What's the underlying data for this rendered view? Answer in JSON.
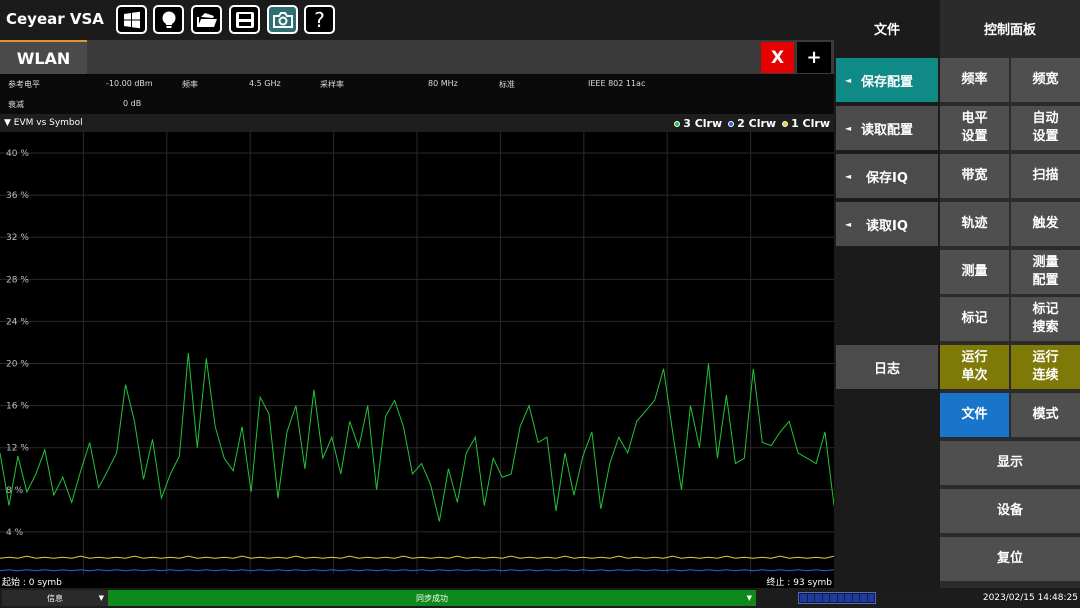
{
  "app": {
    "title": "Ceyear VSA"
  },
  "toolbar": {
    "icons": [
      "windows-icon",
      "lightbulb-icon",
      "open-folder-icon",
      "save-disk-icon",
      "camera-icon",
      "help-icon"
    ],
    "help_label": "?"
  },
  "tabs": {
    "active": "WLAN",
    "close_label": "X",
    "add_label": "+"
  },
  "info": {
    "ref_level_label": "参考电平",
    "ref_level_value": "-10.00 dBm",
    "freq_label": "频率",
    "freq_value": "4.5 GHz",
    "sample_label": "采样率",
    "sample_value": "80 MHz",
    "standard_label": "标准",
    "standard_value": "IEEE 802 11ac",
    "atten_label": "衰减",
    "atten_value": "0 dB"
  },
  "chart_header": {
    "title": "▼ EVM vs Symbol",
    "legend": [
      {
        "label": "3 Clrw",
        "color": "#22c43a"
      },
      {
        "label": "2 Clrw",
        "color": "#2f5ee8"
      },
      {
        "label": "1 Clrw",
        "color": "#e3d22b"
      }
    ]
  },
  "chart_data": {
    "type": "line",
    "title": "EVM vs Symbol",
    "xlabel": "",
    "ylabel": "",
    "x_range": [
      0,
      93
    ],
    "ylim": [
      0,
      42
    ],
    "yticks": [
      "40 %",
      "36 %",
      "32 %",
      "28 %",
      "24 %",
      "20 %",
      "16 %",
      "12 %",
      "8 %",
      "4 %"
    ],
    "ytick_values": [
      40,
      36,
      32,
      28,
      24,
      20,
      16,
      12,
      8,
      4
    ],
    "grid": true,
    "series": [
      {
        "name": "3 Clrw",
        "color": "#22c43a",
        "values": [
          11.5,
          6.5,
          11.2,
          7.8,
          9.5,
          11.8,
          7.5,
          9.2,
          6.8,
          9.8,
          12.5,
          8.2,
          9.8,
          11.5,
          18.0,
          14.5,
          9.0,
          12.8,
          7.2,
          9.5,
          11.2,
          21.0,
          12.0,
          20.5,
          14.0,
          11.0,
          9.8,
          14.0,
          7.8,
          16.8,
          15.2,
          7.2,
          13.5,
          16.0,
          10.0,
          17.5,
          11.0,
          13.0,
          9.5,
          14.5,
          12.0,
          16.0,
          8.0,
          15.0,
          16.5,
          14.0,
          9.5,
          10.5,
          8.5,
          5.0,
          10.0,
          6.8,
          11.5,
          13.0,
          6.5,
          11.0,
          9.2,
          9.5,
          14.0,
          16.0,
          12.5,
          13.0,
          6.0,
          11.5,
          7.5,
          11.2,
          13.5,
          6.2,
          10.5,
          13.0,
          11.5,
          14.5,
          15.5,
          16.5,
          19.5,
          13.5,
          8.0,
          16.0,
          12.0,
          20.0,
          11.0,
          17.0,
          10.5,
          11.0,
          19.5,
          12.5,
          12.2,
          13.5,
          14.5,
          11.5,
          11.0,
          10.5,
          13.5,
          6.5
        ]
      },
      {
        "name": "2 Clrw",
        "color": "#2f5ee8",
        "values": [
          0.3,
          0.4,
          0.3,
          0.4,
          0.3,
          0.4,
          0.3,
          0.4,
          0.3,
          0.4,
          0.3,
          0.4,
          0.3,
          0.4,
          0.3,
          0.4,
          0.3,
          0.4,
          0.3,
          0.4,
          0.3,
          0.4,
          0.3,
          0.4,
          0.3,
          0.4,
          0.3,
          0.4,
          0.3,
          0.4,
          0.3,
          0.4,
          0.3,
          0.4,
          0.3,
          0.4,
          0.3,
          0.4,
          0.3,
          0.4,
          0.3,
          0.4,
          0.3,
          0.4,
          0.3,
          0.4,
          0.3,
          0.4,
          0.3,
          0.4,
          0.3,
          0.4,
          0.3,
          0.4,
          0.3,
          0.4,
          0.3,
          0.4,
          0.3,
          0.4,
          0.3,
          0.4,
          0.3,
          0.4,
          0.3,
          0.4,
          0.3,
          0.4,
          0.3,
          0.4,
          0.3,
          0.4,
          0.3,
          0.4,
          0.3,
          0.4,
          0.3,
          0.4,
          0.3,
          0.4,
          0.3,
          0.4,
          0.3,
          0.4,
          0.3,
          0.4,
          0.3,
          0.4,
          0.3,
          0.4,
          0.3,
          0.4,
          0.3,
          0.4
        ]
      },
      {
        "name": "1 Clrw",
        "color": "#e3d22b",
        "values": [
          1.5,
          1.6,
          1.5,
          1.7,
          1.5,
          1.6,
          1.5,
          1.6,
          1.5,
          1.7,
          1.5,
          1.6,
          1.5,
          1.6,
          1.5,
          1.7,
          1.5,
          1.6,
          1.5,
          1.6,
          1.5,
          1.7,
          1.5,
          1.6,
          1.5,
          1.6,
          1.5,
          1.7,
          1.5,
          1.6,
          1.5,
          1.6,
          1.5,
          1.7,
          1.5,
          1.6,
          1.5,
          1.6,
          1.5,
          1.7,
          1.5,
          1.6,
          1.5,
          1.6,
          1.5,
          1.7,
          1.5,
          1.6,
          1.5,
          1.6,
          1.5,
          1.7,
          1.5,
          1.6,
          1.5,
          1.6,
          1.5,
          1.7,
          1.5,
          1.6,
          1.5,
          1.6,
          1.5,
          1.7,
          1.5,
          1.6,
          1.5,
          1.6,
          1.5,
          1.7,
          1.5,
          1.6,
          1.5,
          1.6,
          1.5,
          1.7,
          1.5,
          1.6,
          1.5,
          1.6,
          1.5,
          1.7,
          1.5,
          1.6,
          1.5,
          1.6,
          1.5,
          1.7,
          1.5,
          1.6,
          1.5,
          1.6,
          1.5,
          1.7,
          1.5,
          1.6
        ]
      }
    ]
  },
  "xaxis": {
    "start": "起始 : 0 symb",
    "stop": "终止 : 93 symb"
  },
  "status": {
    "info_label": "信息",
    "message": "同步成功",
    "datetime": "2023/02/15 14:48:25"
  },
  "file_panel": {
    "header": "文件",
    "items": [
      "保存配置",
      "读取配置",
      "保存IQ",
      "读取IQ"
    ],
    "log_label": "日志"
  },
  "control_panel": {
    "header": "控制面板",
    "freq": "频率",
    "span": "频宽",
    "level": "电平\n设置",
    "auto": "自动\n设置",
    "bandwidth": "带宽",
    "sweep": "扫描",
    "trace": "轨迹",
    "trigger": "触发",
    "measure": "测量",
    "meas_config": "测量\n配置",
    "marker": "标记",
    "marker_search": "标记\n搜索",
    "run_single": "运行\n单次",
    "run_cont": "运行\n连续",
    "file": "文件",
    "mode": "模式",
    "display": "显示",
    "device": "设备",
    "reset": "复位"
  }
}
